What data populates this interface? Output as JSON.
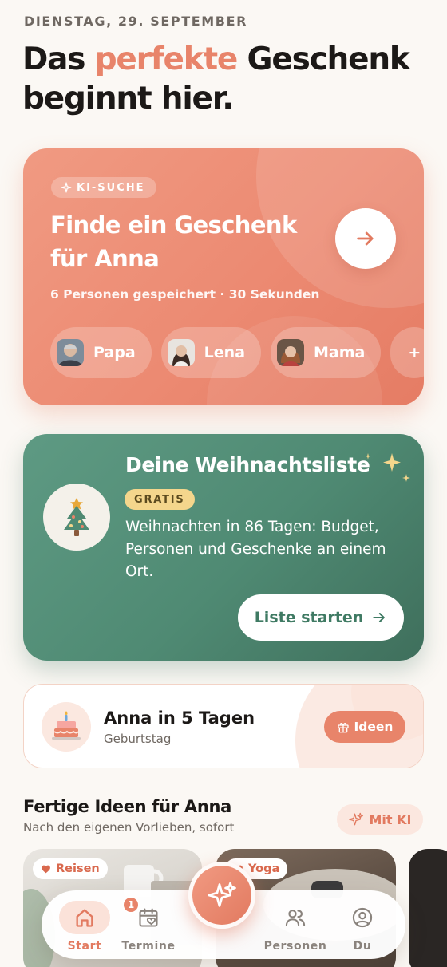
{
  "header": {
    "date": "DIENSTAG, 29. SEPTEMBER",
    "headline_part1": "Das ",
    "headline_accent": "perfekte",
    "headline_part2": " Geschenk beginnt hier."
  },
  "ai_card": {
    "badge": "KI-SUCHE",
    "title": "Finde ein Geschenk für Anna",
    "subtitle": "6 Personen gespeichert · 30 Sekunden",
    "go_icon": "arrow-right-icon",
    "people": [
      {
        "name": "Papa",
        "avatar": "avatar-papa"
      },
      {
        "name": "Lena",
        "avatar": "avatar-lena"
      },
      {
        "name": "Mama",
        "avatar": "avatar-mama"
      }
    ],
    "more_label": "+"
  },
  "xmas_card": {
    "title": "Deine Weihnachtsliste",
    "badge": "GRATIS",
    "text": "Weihnachten in 86 Tagen: Budget, Personen und Geschenke an einem Ort.",
    "button": "Liste starten",
    "icon": "christmas-tree-icon"
  },
  "birthday_card": {
    "name": "Anna in 5 Tagen",
    "type": "Geburtstag",
    "button": "Ideen",
    "icon": "birthday-cake-icon"
  },
  "ideas": {
    "title": "Fertige Ideen für Anna",
    "subtitle": "Nach den eigenen Vorlieben, sofort",
    "ki_button": "Mit KI",
    "cards": [
      {
        "tag": "Reisen"
      },
      {
        "tag": "Yoga"
      }
    ]
  },
  "nav": {
    "items": [
      {
        "label": "Start",
        "icon": "home-icon",
        "active": true
      },
      {
        "label": "Termine",
        "icon": "calendar-heart-icon",
        "badge": "1"
      },
      {
        "label": "Personen",
        "icon": "people-icon"
      },
      {
        "label": "Du",
        "icon": "profile-icon"
      }
    ],
    "fab_icon": "sparkle-icon"
  },
  "colors": {
    "accent": "#e8846a",
    "green": "#4f8a73",
    "background": "#fbf8f4"
  }
}
